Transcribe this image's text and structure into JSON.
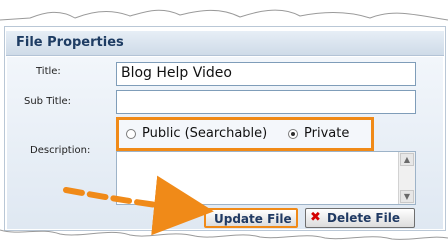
{
  "panel": {
    "title": "File Properties",
    "fields": {
      "title_label": "Title:",
      "title_value": "Blog Help Video",
      "subtitle_label": "Sub Title:",
      "subtitle_value": "",
      "description_label": "Description:"
    },
    "privacy": {
      "options": [
        {
          "label": "Public (Searchable)",
          "selected": false
        },
        {
          "label": "Private",
          "selected": true
        }
      ]
    },
    "buttons": {
      "update": "Update File",
      "delete": "Delete File"
    }
  },
  "icons": {
    "delete": "x-icon",
    "scroll_up": "chevron-up-icon",
    "scroll_down": "chevron-down-icon",
    "pointer": "arrow-icon"
  },
  "colors": {
    "highlight": "#f08a18",
    "header_text": "#1e3c63",
    "delete_icon": "#d40000"
  }
}
